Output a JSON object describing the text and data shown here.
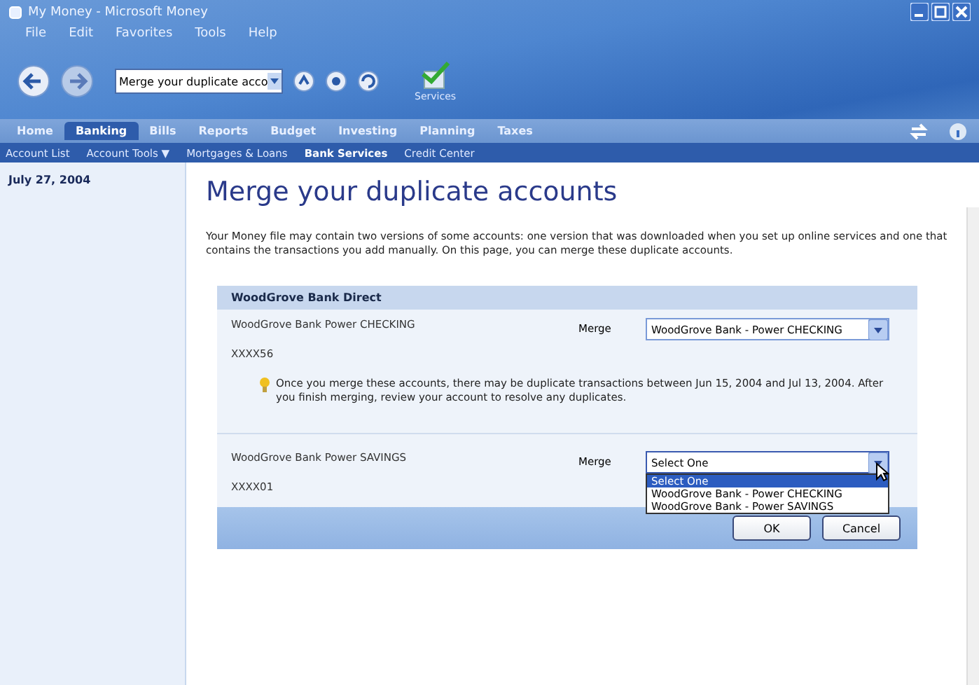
{
  "window": {
    "title": "My Money - Microsoft Money"
  },
  "menu": [
    "File",
    "Edit",
    "Favorites",
    "Tools",
    "Help"
  ],
  "address": {
    "value": "Merge your duplicate acco"
  },
  "toolbar_label": "Services",
  "tabs": [
    {
      "label": "Home",
      "selected": false
    },
    {
      "label": "Banking",
      "selected": true
    },
    {
      "label": "Bills",
      "selected": false
    },
    {
      "label": "Reports",
      "selected": false
    },
    {
      "label": "Budget",
      "selected": false
    },
    {
      "label": "Investing",
      "selected": false
    },
    {
      "label": "Planning",
      "selected": false
    },
    {
      "label": "Taxes",
      "selected": false
    }
  ],
  "subnav": [
    {
      "label": "Account List",
      "selected": false
    },
    {
      "label": "Account Tools ▼",
      "selected": false
    },
    {
      "label": "Mortgages & Loans",
      "selected": false
    },
    {
      "label": "Bank Services",
      "selected": true
    },
    {
      "label": "Credit Center",
      "selected": false
    }
  ],
  "sidebar": {
    "date": "July 27, 2004"
  },
  "page": {
    "heading": "Merge your duplicate accounts",
    "intro": "Your Money file may contain two versions of some accounts: one version that was downloaded when you set up online services and one that contains the transactions you add manually. On this page, you can merge these duplicate accounts.",
    "group": "WoodGrove Bank Direct",
    "accounts": [
      {
        "name": "WoodGrove Bank Power CHECKING",
        "number": "XXXX56",
        "merge_label": "Merge",
        "merge_value": "WoodGrove Bank - Power CHECKING",
        "expanded": false,
        "note": "Once you merge these accounts, there may be duplicate transactions between Jun 15, 2004 and Jul 13, 2004. After you finish merging, review your account to resolve any duplicates."
      },
      {
        "name": "WoodGrove Bank Power SAVINGS",
        "number": "XXXX01",
        "merge_label": "Merge",
        "merge_value": "Select One",
        "expanded": true,
        "options": [
          {
            "label": "Select One",
            "selected": true
          },
          {
            "label": "WoodGrove Bank - Power CHECKING",
            "selected": false
          },
          {
            "label": "WoodGrove Bank - Power SAVINGS",
            "selected": false
          }
        ]
      }
    ],
    "buttons": [
      "OK",
      "Cancel"
    ]
  }
}
